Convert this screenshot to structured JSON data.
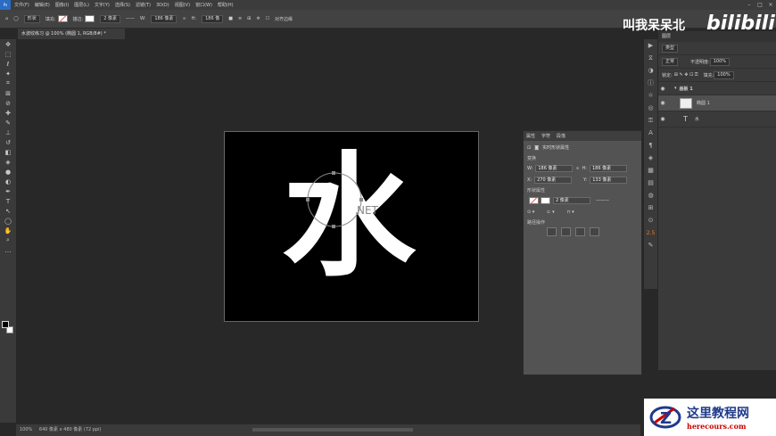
{
  "menu": {
    "ps": "Ps",
    "items": [
      "文件(F)",
      "编辑(E)",
      "图像(I)",
      "图层(L)",
      "文字(Y)",
      "选择(S)",
      "滤镜(T)",
      "3D(D)",
      "视图(V)",
      "窗口(W)",
      "帮助(H)"
    ]
  },
  "options": {
    "mode": "形状",
    "fill_label": "填充:",
    "stroke_label": "描边:",
    "stroke_size": "2 像素",
    "w_label": "W:",
    "w_value": "186 像素",
    "h_label": "H:",
    "h_value": "186 像",
    "align_edges": "对齐边缘"
  },
  "doc_tab": "水波纹练习 @ 100% (椭圆 1, RGB/8#) *",
  "canvas": {
    "text": "水",
    "watermark": "NET"
  },
  "brand": {
    "text": "叫我呆呆北",
    "bili": "bilibili"
  },
  "layers": {
    "tab": "图层",
    "filter": "类型",
    "blend": "正常",
    "opacity_label": "不透明度:",
    "opacity": "100%",
    "lock_label": "锁定:",
    "fill_label": "填充:",
    "fill": "100%",
    "group": "画板 1",
    "items": [
      "椭圆 1",
      "水"
    ]
  },
  "properties": {
    "tabs": [
      "属性",
      "字符",
      "段落"
    ],
    "title": "实时形状属性",
    "section_transform": "变换",
    "w_label": "W:",
    "w": "186 像素",
    "h_label": "H:",
    "h": "186 像素",
    "x_label": "X:",
    "x": "270 像素",
    "y_label": "Y:",
    "y": "133 像素",
    "section_appearance": "形状属性",
    "stroke_size": "2 像素",
    "section_path": "路径操作"
  },
  "status": {
    "zoom": "100%",
    "dims": "640 像素 x 480 像素 (72 ppi)"
  },
  "side_number": "2.5",
  "site": {
    "cn": "这里教程网",
    "en": "herecours.com"
  }
}
